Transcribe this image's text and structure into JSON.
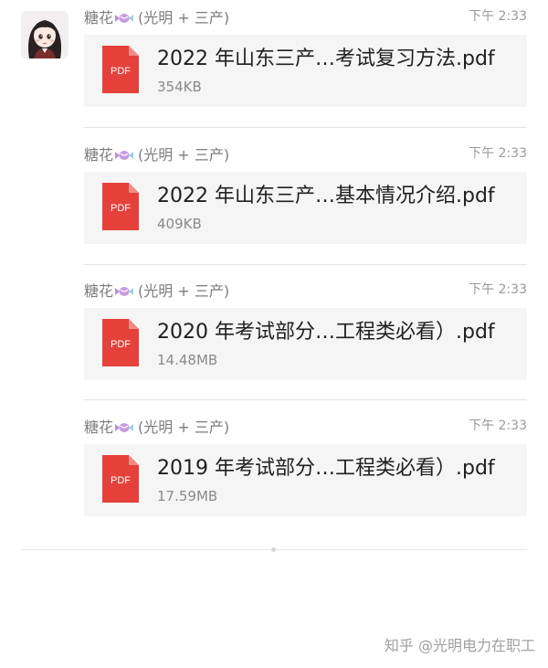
{
  "chat": {
    "messages": [
      {
        "sender_name": "糖花",
        "sender_group": "(光明 + 三产)",
        "time": "下午 2:33",
        "file": {
          "name": "2022 年山东三产…考试复习方法.pdf",
          "size": "354KB",
          "type_label": "PDF"
        }
      },
      {
        "sender_name": "糖花",
        "sender_group": "(光明 + 三产)",
        "time": "下午 2:33",
        "file": {
          "name": "2022 年山东三产…基本情况介绍.pdf",
          "size": "409KB",
          "type_label": "PDF"
        }
      },
      {
        "sender_name": "糖花",
        "sender_group": "(光明 + 三产)",
        "time": "下午 2:33",
        "file": {
          "name": "2020 年考试部分…工程类必看）.pdf",
          "size": "14.48MB",
          "type_label": "PDF"
        }
      },
      {
        "sender_name": "糖花",
        "sender_group": "(光明 + 三产)",
        "time": "下午 2:33",
        "file": {
          "name": "2019 年考试部分…工程类必看）.pdf",
          "size": "17.59MB",
          "type_label": "PDF"
        }
      }
    ]
  },
  "watermark": "知乎 @光明电力在职工",
  "colors": {
    "pdf_icon": "#e5413a",
    "card_background": "#f5f5f5",
    "meta_text": "#7c7c7c"
  },
  "icons": {
    "avatar": "cartoon-girl-avatar",
    "sender_emoji": "candy-icon",
    "file_type": "pdf-file-icon"
  }
}
